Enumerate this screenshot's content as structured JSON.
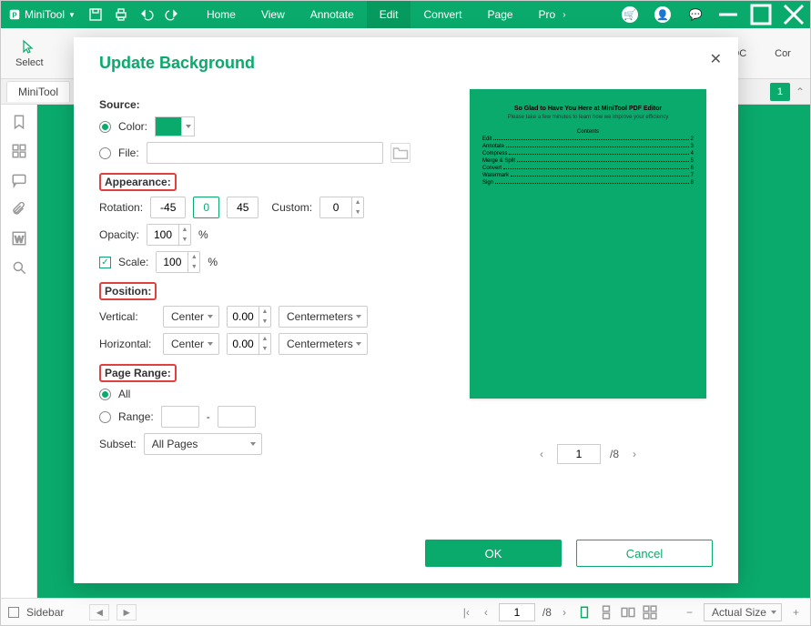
{
  "app": {
    "name": "MiniTool"
  },
  "menu": {
    "items": [
      "Home",
      "View",
      "Annotate",
      "Edit",
      "Convert",
      "Page",
      "Pro"
    ],
    "active": "Edit"
  },
  "toolbar": {
    "select": "Select",
    "toc": "OC",
    "cor": "Cor"
  },
  "tabs": {
    "active": "MiniTool",
    "page_badge": "1"
  },
  "modal": {
    "title": "Update Background",
    "source": {
      "label": "Source:",
      "color_label": "Color:",
      "file_label": "File:",
      "color": "#0aaa6c"
    },
    "appearance": {
      "label": "Appearance:",
      "rotation_label": "Rotation:",
      "rot_neg": "-45",
      "rot_zero": "0",
      "rot_pos": "45",
      "custom_label": "Custom:",
      "custom_val": "0",
      "opacity_label": "Opacity:",
      "opacity_val": "100",
      "opacity_unit": "%",
      "scale_label": "Scale:",
      "scale_val": "100",
      "scale_unit": "%"
    },
    "position": {
      "label": "Position:",
      "vertical_label": "Vertical:",
      "horizontal_label": "Horizontal:",
      "align_val": "Center",
      "offset_val": "0.00",
      "unit_val": "Centermeters"
    },
    "range": {
      "label": "Page Range:",
      "all_label": "All",
      "range_label": "Range:",
      "dash": "-",
      "subset_label": "Subset:",
      "subset_val": "All Pages"
    },
    "preview": {
      "title": "So Glad to Have You Here at MiniTool PDF Editor",
      "subtitle": "Please take a few minutes to learn how we improve your efficiency",
      "contents": "Contents",
      "toc": [
        {
          "t": "Edit",
          "p": "2"
        },
        {
          "t": "Annotate",
          "p": "3"
        },
        {
          "t": "Compress",
          "p": "4"
        },
        {
          "t": "Merge & Split",
          "p": "5"
        },
        {
          "t": "Convert",
          "p": "6"
        },
        {
          "t": "Watermark",
          "p": "7"
        },
        {
          "t": "Sign",
          "p": "8"
        }
      ],
      "current_page": "1",
      "total_pages": "/8"
    },
    "actions": {
      "ok": "OK",
      "cancel": "Cancel"
    }
  },
  "statusbar": {
    "sidebar_label": "Sidebar",
    "page_current": "1",
    "page_total": "/8",
    "zoom_label": "Actual Size"
  }
}
